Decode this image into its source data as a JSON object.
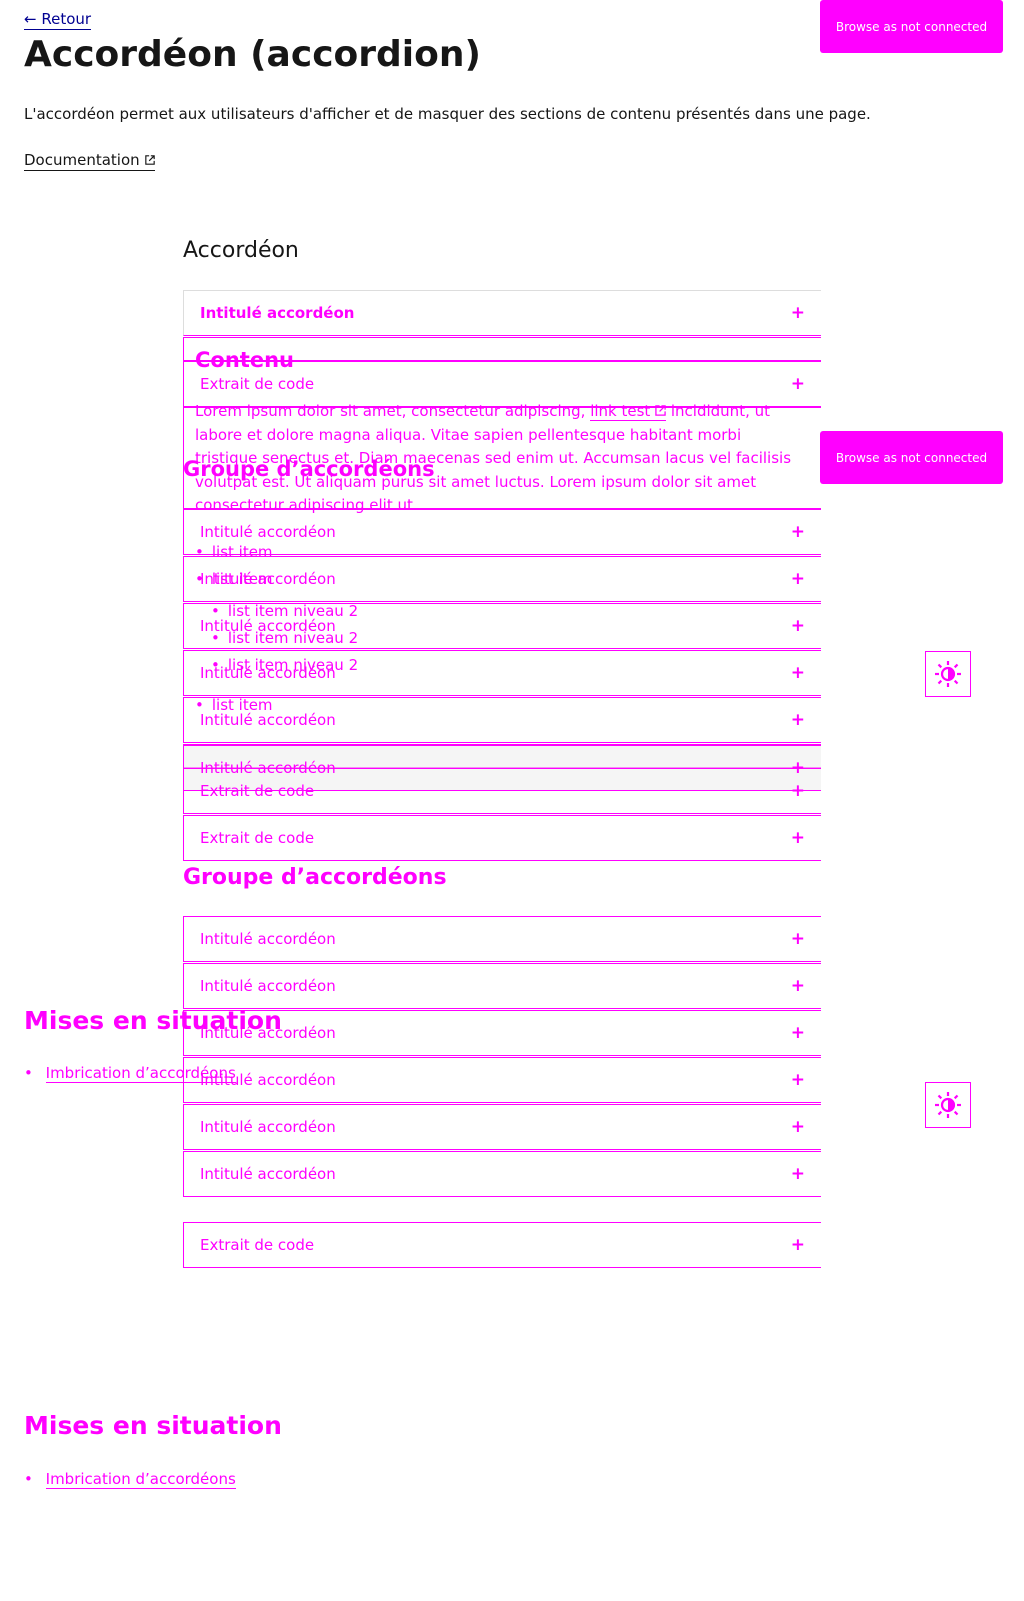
{
  "nav": {
    "back_label": "Retour"
  },
  "header": {
    "title": "Accordéon (accordion)",
    "lead": "L'accordéon permet aux utilisateurs d'afficher et de masquer des sections de contenu présentés dans une page.",
    "doc_link": "Documentation"
  },
  "toolbar": {
    "pill_label": "Browse as not connected"
  },
  "demo": {
    "section_title": "Accordéon",
    "accordion_label": "Intitulé accordéon",
    "code_label": "Extrait de code",
    "content_title": "Contenu",
    "paragraph_1": "Lorem ipsum dolor sit amet, consectetur adipiscing,",
    "paragraph_link": "link test",
    "paragraph_2": "incididunt, ut",
    "paragraph_lines": [
      "labore et dolore magna aliqua. Vitae sapien pellentesque habitant morbi",
      "tristique senectus et. Diam maecenas sed enim ut. Accumsan lacus vel facilisis",
      "volutpat est. Ut aliquam purus sit amet luctus. Lorem ipsum dolor sit amet",
      "consectetur adipiscing elit ut."
    ],
    "list_item": "list item",
    "list_item_level2": "list item niveau 2"
  },
  "group": {
    "section_title": "Groupe d’accordéons"
  },
  "situations": {
    "section_title": "Mises en situation",
    "items": [
      "Imbrication d’accordéons"
    ]
  },
  "colors": {
    "accent": "#ff00ff",
    "link": "#000091",
    "text": "#161616"
  }
}
